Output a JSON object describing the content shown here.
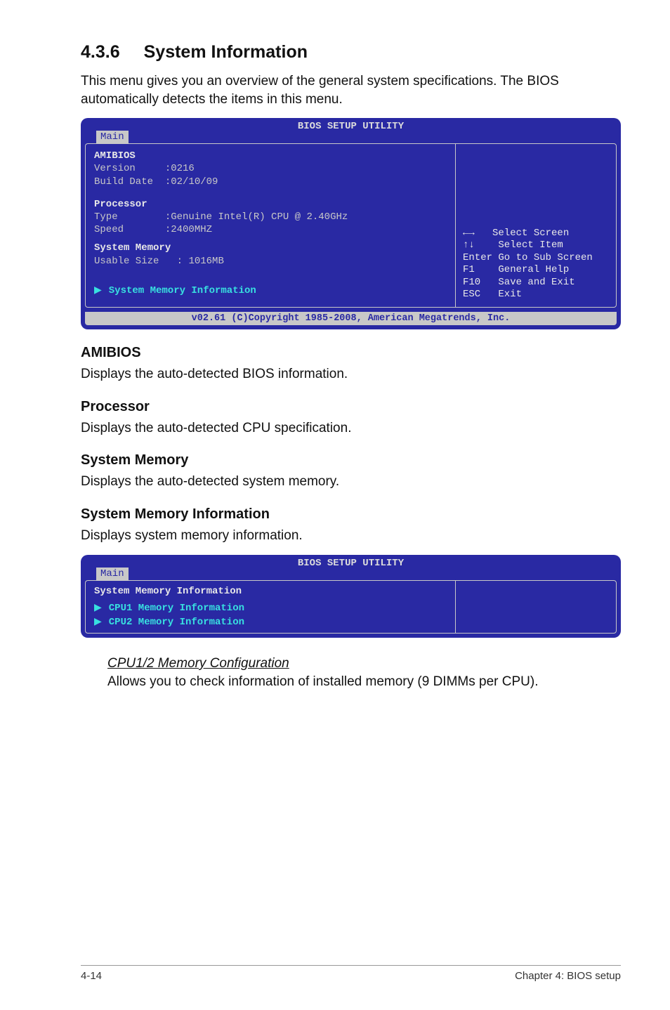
{
  "section": {
    "number": "4.3.6",
    "title": "System Information",
    "intro": "This menu gives you an overview of the general system specifications. The BIOS automatically detects the items in this menu."
  },
  "bios1": {
    "title": "BIOS SETUP UTILITY",
    "tab": "Main",
    "amibios": {
      "heading": "AMIBIOS",
      "version_label": "Version",
      "version_value": ":0216",
      "build_label": "Build Date",
      "build_value": ":02/10/09"
    },
    "processor": {
      "heading": "Processor",
      "type_label": "Type",
      "type_value": ":Genuine Intel(R) CPU @ 2.40GHz",
      "speed_label": "Speed",
      "speed_value": ":2400MHZ"
    },
    "memory": {
      "heading": "System Memory",
      "usable_label": "Usable Size",
      "usable_value": ": 1016MB"
    },
    "submenu": "System Memory Information",
    "nav": {
      "lr": "←→   Select Screen",
      "ud": "↑↓    Select Item",
      "enter": "Enter Go to Sub Screen",
      "f1": "F1    General Help",
      "f10": "F10   Save and Exit",
      "esc": "ESC   Exit"
    },
    "footer": "v02.61 (C)Copyright 1985-2008, American Megatrends, Inc."
  },
  "subs": {
    "amibios": {
      "h": "AMIBIOS",
      "p": "Displays the auto-detected BIOS information."
    },
    "processor": {
      "h": "Processor",
      "p": "Displays the auto-detected CPU specification."
    },
    "sysmem": {
      "h": "System Memory",
      "p": "Displays the auto-detected system memory."
    },
    "sysmeminfo": {
      "h": "System Memory Information",
      "p": "Displays system memory information."
    }
  },
  "bios2": {
    "title": "BIOS SETUP UTILITY",
    "tab": "Main",
    "heading": "System Memory Information",
    "items": [
      "CPU1 Memory Information",
      "CPU2 Memory Information"
    ]
  },
  "cpu12": {
    "h": "CPU1/2 Memory Configuration",
    "p": "Allows you to check information of installed memory (9 DIMMs per CPU)."
  },
  "footer": {
    "left": "4-14",
    "right": "Chapter 4: BIOS setup"
  }
}
